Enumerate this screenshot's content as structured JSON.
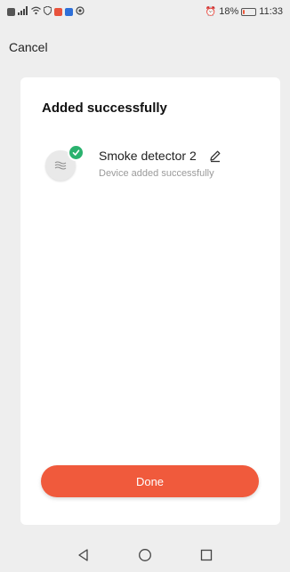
{
  "status_bar": {
    "alarm_glyph": "⏰",
    "battery_percent": "18%",
    "battery_level": 0.18,
    "time": "11:33"
  },
  "header": {
    "cancel_label": "Cancel"
  },
  "card": {
    "title": "Added successfully",
    "device": {
      "name": "Smoke detector 2",
      "status": "Device added successfully",
      "icon": "smoke-detector-icon"
    },
    "done_label": "Done"
  },
  "colors": {
    "accent": "#f05a3c",
    "success": "#2ab26e",
    "background": "#eeeeee",
    "card": "#ffffff"
  }
}
